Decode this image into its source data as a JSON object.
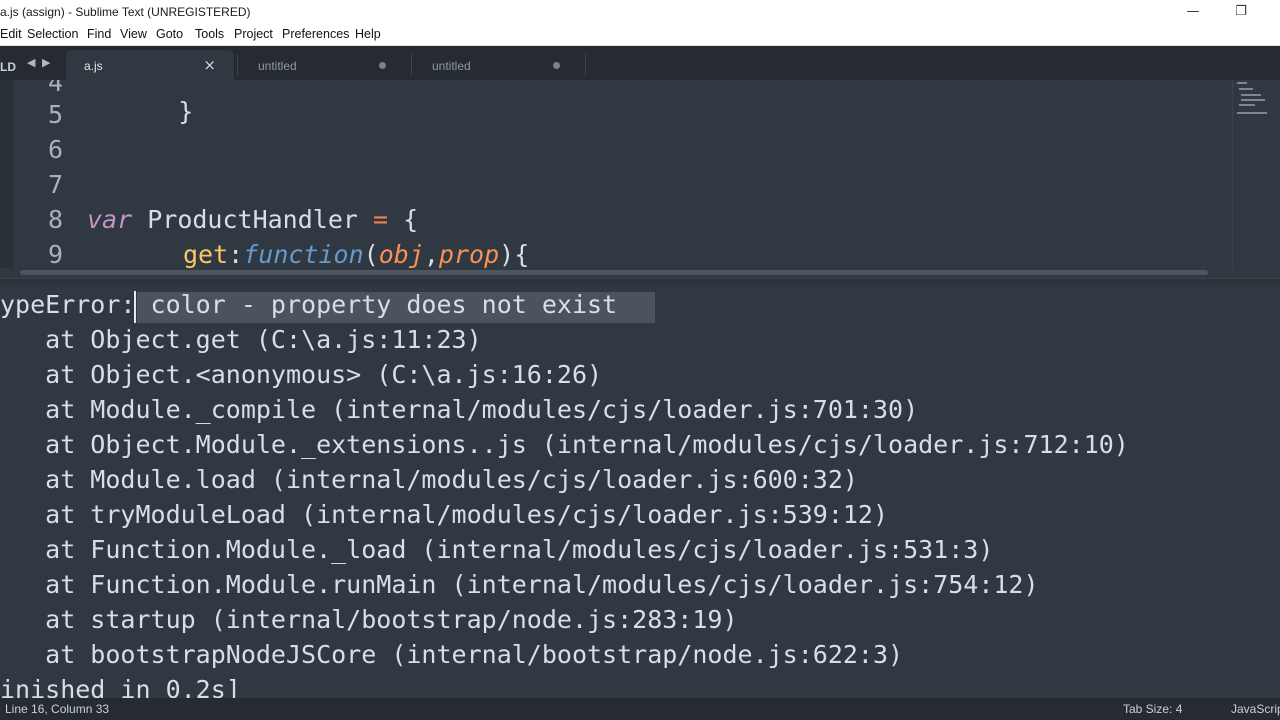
{
  "window": {
    "title": "a.js (assign) - Sublime Text (UNREGISTERED)",
    "minimize_glyph": "—",
    "restore_glyph": "❐"
  },
  "menu": [
    "Edit",
    "Selection",
    "Find",
    "View",
    "Goto",
    "Tools",
    "Project",
    "Preferences",
    "Help"
  ],
  "sidebar": {
    "label": "LD",
    "back_glyph": "◀",
    "forward_glyph": "▶"
  },
  "tabs": [
    {
      "label": "a.js",
      "close_glyph": "×",
      "active": true
    },
    {
      "label": "untitled",
      "modified": true
    },
    {
      "label": "untitled",
      "modified": true
    }
  ],
  "editor": {
    "line_numbers": [
      "4",
      "5",
      "6",
      "7",
      "8",
      "9"
    ],
    "line4": "}",
    "line8": {
      "kw": "var",
      "name": "ProductHandler",
      "op": "=",
      "brace": "{"
    },
    "line9": {
      "prop": "get",
      "colon": ":",
      "kw": "function",
      "open": "(",
      "p1": "obj",
      "comma": ",",
      "p2": "prop",
      "close": "){"
    }
  },
  "output": {
    "lines": [
      "ypeError: color - property does not exist",
      "   at Object.get (C:\\a.js:11:23)",
      "   at Object.<anonymous> (C:\\a.js:16:26)",
      "   at Module._compile (internal/modules/cjs/loader.js:701:30)",
      "   at Object.Module._extensions..js (internal/modules/cjs/loader.js:712:10)",
      "   at Module.load (internal/modules/cjs/loader.js:600:32)",
      "   at tryModuleLoad (internal/modules/cjs/loader.js:539:12)",
      "   at Function.Module._load (internal/modules/cjs/loader.js:531:3)",
      "   at Function.Module.runMain (internal/modules/cjs/loader.js:754:12)",
      "   at startup (internal/bootstrap/node.js:283:19)",
      "   at bootstrapNodeJSCore (internal/bootstrap/node.js:622:3)",
      "inished in 0.2s]"
    ]
  },
  "status": {
    "position": "Line 16, Column 33",
    "tab_size": "Tab Size: 4",
    "syntax": "JavaScript"
  }
}
